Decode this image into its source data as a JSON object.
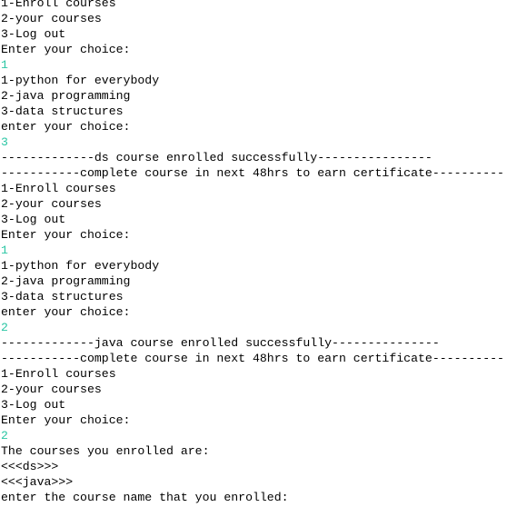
{
  "console": {
    "lines": [
      {
        "text": "1-Enroll courses",
        "kind": "output"
      },
      {
        "text": "2-your courses",
        "kind": "output"
      },
      {
        "text": "3-Log out",
        "kind": "output"
      },
      {
        "text": "Enter your choice:",
        "kind": "output"
      },
      {
        "text": "1",
        "kind": "input"
      },
      {
        "text": "1-python for everybody",
        "kind": "output"
      },
      {
        "text": "2-java programming",
        "kind": "output"
      },
      {
        "text": "3-data structures",
        "kind": "output"
      },
      {
        "text": "enter your choice:",
        "kind": "output"
      },
      {
        "text": "3",
        "kind": "input"
      },
      {
        "text": "-------------ds course enrolled successfully----------------",
        "kind": "output"
      },
      {
        "text": "-----------complete course in next 48hrs to earn certificate----------",
        "kind": "output"
      },
      {
        "text": "1-Enroll courses",
        "kind": "output"
      },
      {
        "text": "2-your courses",
        "kind": "output"
      },
      {
        "text": "3-Log out",
        "kind": "output"
      },
      {
        "text": "Enter your choice:",
        "kind": "output"
      },
      {
        "text": "1",
        "kind": "input"
      },
      {
        "text": "1-python for everybody",
        "kind": "output"
      },
      {
        "text": "2-java programming",
        "kind": "output"
      },
      {
        "text": "3-data structures",
        "kind": "output"
      },
      {
        "text": "enter your choice:",
        "kind": "output"
      },
      {
        "text": "2",
        "kind": "input"
      },
      {
        "text": "-------------java course enrolled successfully---------------",
        "kind": "output"
      },
      {
        "text": "-----------complete course in next 48hrs to earn certificate----------",
        "kind": "output"
      },
      {
        "text": "1-Enroll courses",
        "kind": "output"
      },
      {
        "text": "2-your courses",
        "kind": "output"
      },
      {
        "text": "3-Log out",
        "kind": "output"
      },
      {
        "text": "Enter your choice:",
        "kind": "output"
      },
      {
        "text": "2",
        "kind": "input"
      },
      {
        "text": "The courses you enrolled are:",
        "kind": "output"
      },
      {
        "text": "<<<ds>>>",
        "kind": "output"
      },
      {
        "text": "<<<java>>>",
        "kind": "output"
      },
      {
        "text": "enter the course name that you enrolled:",
        "kind": "output"
      }
    ]
  },
  "colors": {
    "background": "#ffffff",
    "output_text": "#000000",
    "input_text": "#2bc6a4"
  }
}
